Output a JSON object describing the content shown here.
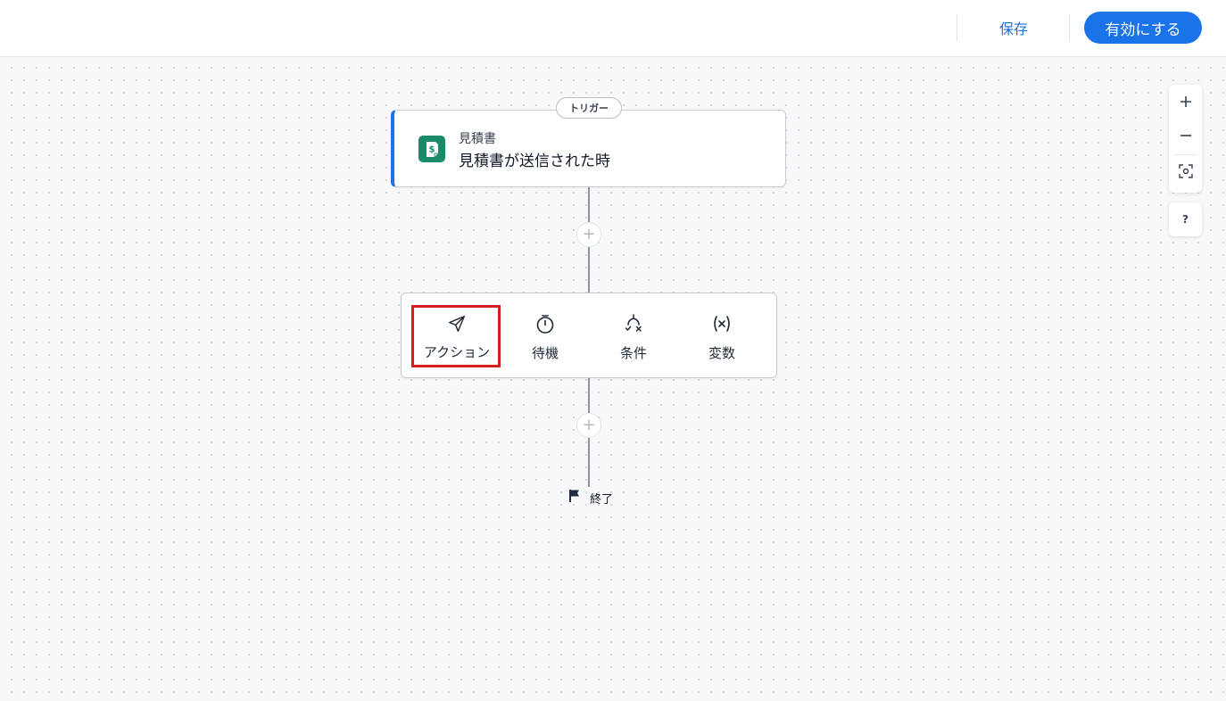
{
  "header": {
    "save_label": "保存",
    "activate_label": "有効にする"
  },
  "trigger": {
    "pill_label": "トリガー",
    "app_name": "見積書",
    "event_title": "見積書が送信された時",
    "icon": "dollar-document-icon"
  },
  "step_menu": {
    "items": [
      {
        "label": "アクション",
        "icon": "send-icon"
      },
      {
        "label": "待機",
        "icon": "stopwatch-icon"
      },
      {
        "label": "条件",
        "icon": "branch-icon"
      },
      {
        "label": "変数",
        "icon": "variable-icon"
      }
    ]
  },
  "end_node": {
    "label": "終了",
    "icon": "flag-icon"
  },
  "zoom_controls": {
    "zoom_in_icon": "plus-icon",
    "zoom_out_icon": "minus-icon",
    "fit_icon": "fit-view-icon"
  },
  "help": {
    "label": "?"
  },
  "colors": {
    "primary": "#1a73e8",
    "highlight": "#d32020",
    "app_icon": "#1b8a6b"
  }
}
